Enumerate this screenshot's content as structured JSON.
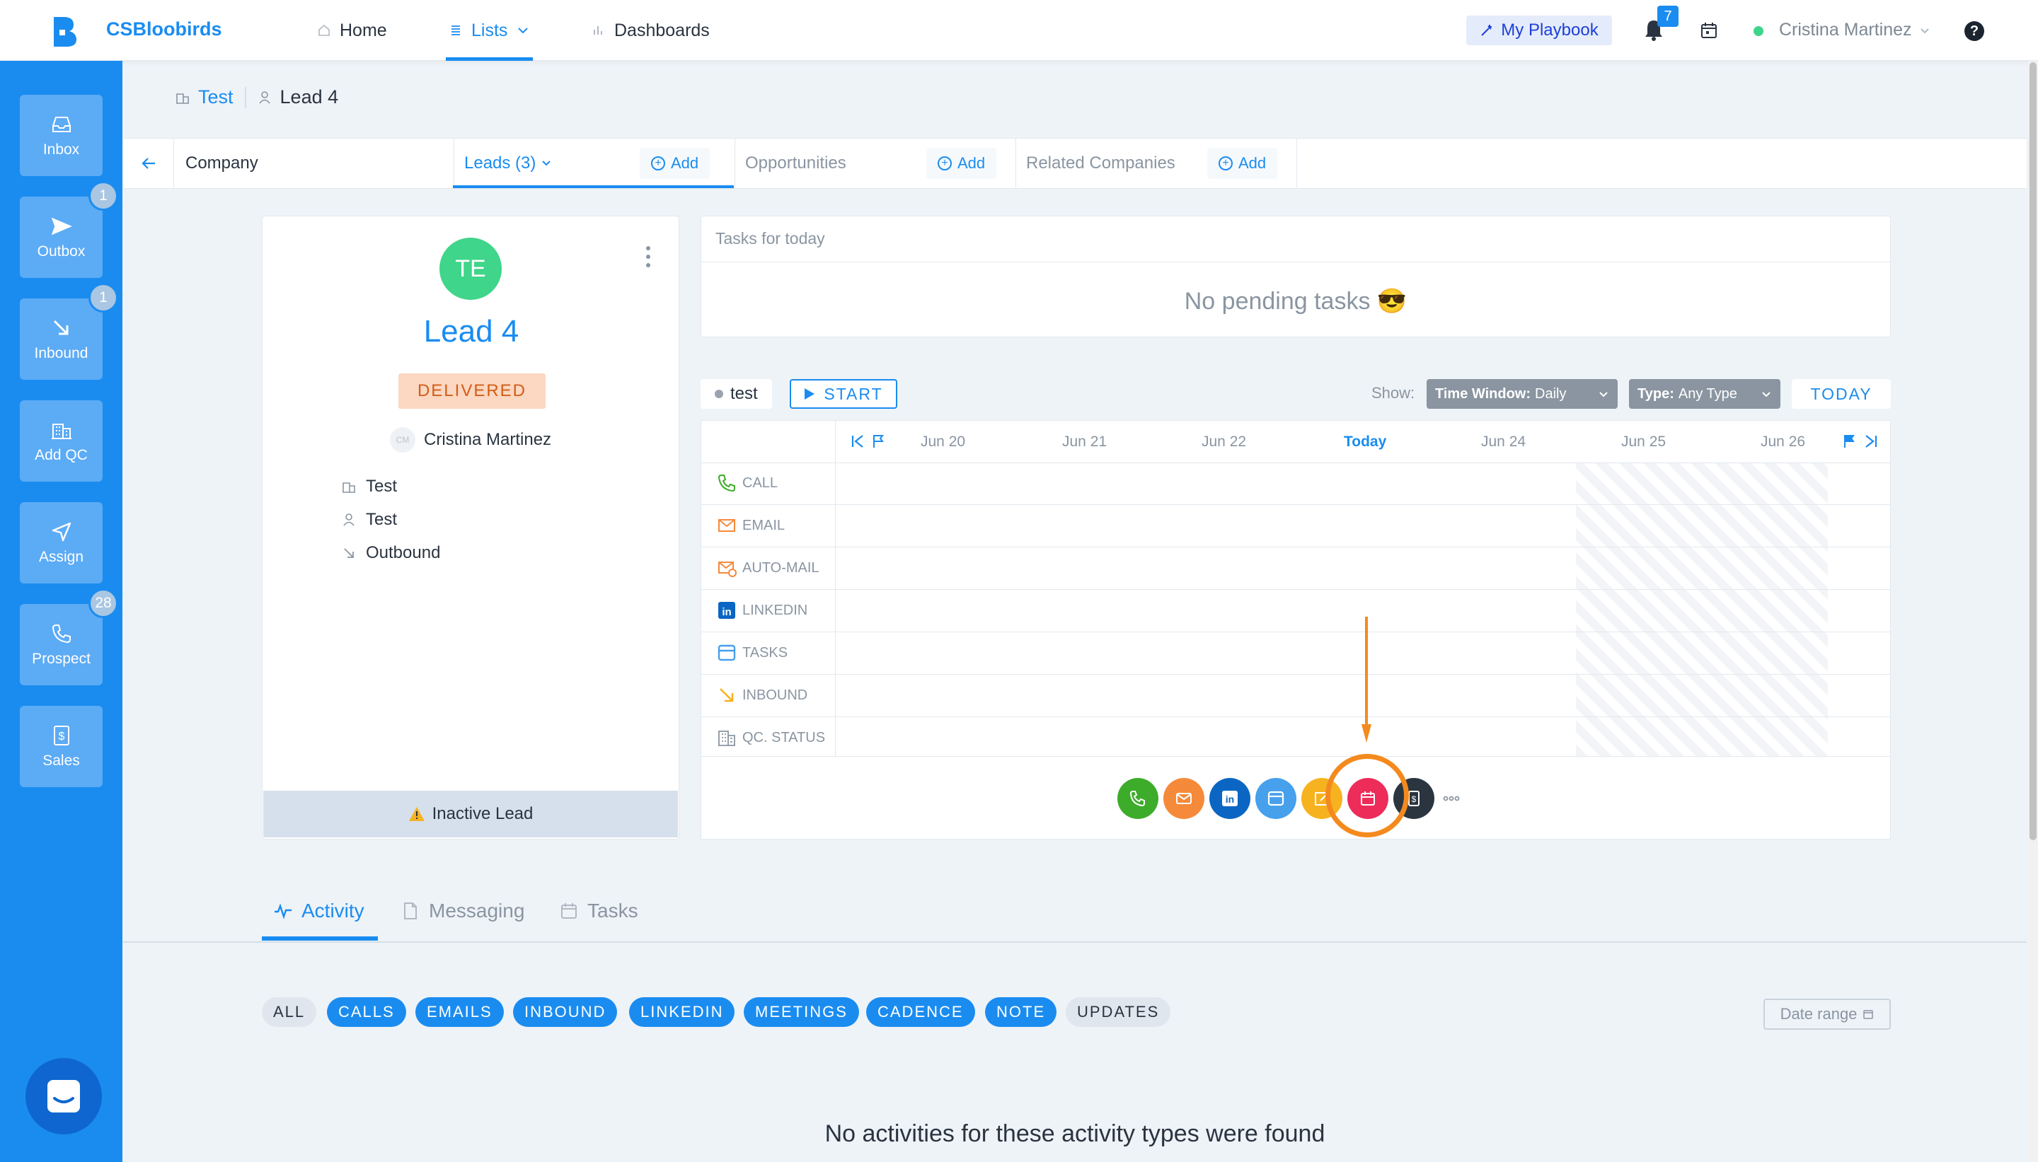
{
  "app": {
    "brand": "CSBloobirds"
  },
  "topnav": {
    "home": "Home",
    "lists": "Lists",
    "dashboards": "Dashboards",
    "playbook": "My Playbook",
    "notifications_count": "7",
    "user_name": "Cristina Martinez",
    "help": "?"
  },
  "sidebar": {
    "items": [
      {
        "label": "Inbox",
        "icon": "inbox-icon",
        "badge": ""
      },
      {
        "label": "Outbox",
        "icon": "send-icon",
        "badge": "1"
      },
      {
        "label": "Inbound",
        "icon": "arrow-down-right-icon",
        "badge": "1"
      },
      {
        "label": "Add QC",
        "icon": "building-icon",
        "badge": ""
      },
      {
        "label": "Assign",
        "icon": "navigation-icon",
        "badge": ""
      },
      {
        "label": "Prospect",
        "icon": "phone-icon",
        "badge": "28"
      },
      {
        "label": "Sales",
        "icon": "dollar-icon",
        "badge": ""
      }
    ]
  },
  "breadcrumb": {
    "company": "Test",
    "lead": "Lead 4"
  },
  "tabbar": {
    "company": "Company",
    "leads": "Leads (3)",
    "opportunities": "Opportunities",
    "related": "Related Companies",
    "add": "Add"
  },
  "lead": {
    "initials": "TE",
    "name": "Lead 4",
    "status": "DELIVERED",
    "owner_initials": "CM",
    "owner": "Cristina Martinez",
    "company": "Test",
    "contact": "Test",
    "source": "Outbound",
    "inactive": "Inactive Lead"
  },
  "tasks": {
    "title": "Tasks for today",
    "empty": "No pending tasks 😎"
  },
  "cadence": {
    "name": "test",
    "start": "START",
    "show_label": "Show:",
    "time_window_label": "Time Window:",
    "time_window_value": "Daily",
    "type_label": "Type:",
    "type_value": "Any Type",
    "today": "TODAY",
    "days": [
      "Jun 20",
      "Jun 21",
      "Jun 22",
      "Today",
      "Jun 24",
      "Jun 25",
      "Jun 26"
    ],
    "rows": [
      "CALL",
      "EMAIL",
      "AUTO-MAIL",
      "LINKEDIN",
      "TASKS",
      "INBOUND",
      "QC. STATUS"
    ]
  },
  "actions": [
    {
      "name": "call-action",
      "color": "#3dac2a"
    },
    {
      "name": "email-action",
      "color": "#f58a3b"
    },
    {
      "name": "linkedin-action",
      "color": "#0a66c2"
    },
    {
      "name": "task-action",
      "color": "#46a0ec"
    },
    {
      "name": "note-action",
      "color": "#f7b21f"
    },
    {
      "name": "meeting-action",
      "color": "#ed2c5a"
    },
    {
      "name": "opportunity-action",
      "color": "#2b3540"
    }
  ],
  "bottom_tabs": {
    "activity": "Activity",
    "messaging": "Messaging",
    "tasks": "Tasks"
  },
  "filters": [
    "ALL",
    "CALLS",
    "EMAILS",
    "INBOUND",
    "LINKEDIN",
    "MEETINGS",
    "CADENCE",
    "NOTE",
    "UPDATES"
  ],
  "date_range": "Date range",
  "no_activities": "No activities for these activity types were found",
  "colors": {
    "brand": "#1a8cf0",
    "highlight": "#f48a1e"
  }
}
